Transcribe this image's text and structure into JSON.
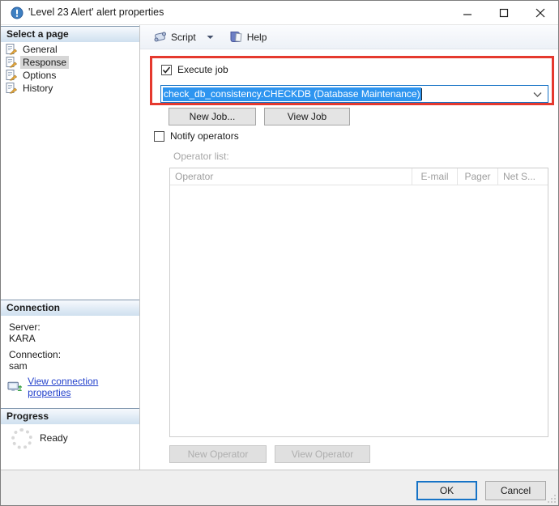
{
  "window": {
    "title": "'Level 23 Alert' alert properties"
  },
  "icons": {
    "titlebar": "alert-info-icon",
    "window_controls": [
      "minimize-icon",
      "maximize-icon",
      "close-icon"
    ],
    "nav_item": "page-properties-icon",
    "toolbar": [
      "script-scroll-icon",
      "dropdown-caret-icon",
      "help-book-icon"
    ],
    "connection_link": "connection-properties-icon",
    "progress": "spinner-icon",
    "combo": "chevron-down-icon",
    "resize": "resize-grip-icon"
  },
  "sidebar": {
    "select_page": {
      "title": "Select a page",
      "items": [
        {
          "label": "General",
          "selected": false
        },
        {
          "label": "Response",
          "selected": true
        },
        {
          "label": "Options",
          "selected": false
        },
        {
          "label": "History",
          "selected": false
        }
      ]
    },
    "connection": {
      "title": "Connection",
      "server_label": "Server:",
      "server_value": "KARA",
      "connection_label": "Connection:",
      "connection_value": "sam",
      "link_label": "View connection properties"
    },
    "progress": {
      "title": "Progress",
      "status": "Ready"
    }
  },
  "toolbar": {
    "script_label": "Script",
    "help_label": "Help"
  },
  "response_page": {
    "execute_job": {
      "label": "Execute job",
      "checked": true,
      "selected_job": "check_db_consistency.CHECKDB (Database Maintenance)"
    },
    "new_job_label": "New Job...",
    "view_job_label": "View Job",
    "notify_operators": {
      "label": "Notify operators",
      "checked": false
    },
    "operator_list_label": "Operator list:",
    "operator_columns": [
      "Operator",
      "E-mail",
      "Pager",
      "Net S..."
    ],
    "operator_rows": [],
    "new_operator_label": "New Operator",
    "view_operator_label": "View Operator"
  },
  "footer": {
    "ok_label": "OK",
    "cancel_label": "Cancel"
  },
  "colors": {
    "highlight_red": "#e5392e",
    "selection_blue": "#2e95f0",
    "combo_focus_border": "#1673c6",
    "ok_focus_border": "#1673c6",
    "link_blue": "#2442cc"
  }
}
